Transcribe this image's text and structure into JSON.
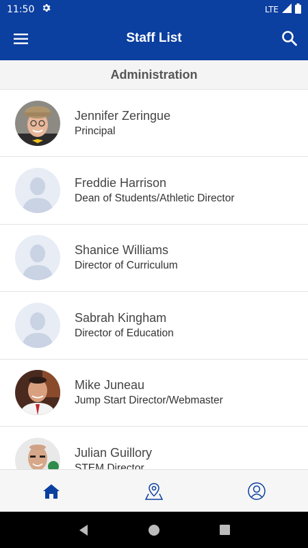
{
  "status_bar": {
    "time": "11:50",
    "network": "LTE",
    "icons": [
      "gear-icon",
      "signal-icon",
      "battery-icon"
    ]
  },
  "app_bar": {
    "title": "Staff List",
    "icons": [
      "menu-icon",
      "search-icon"
    ]
  },
  "section": {
    "title": "Administration"
  },
  "staff": [
    {
      "name": "Jennifer Zeringue",
      "title": "Principal",
      "avatar": "photo"
    },
    {
      "name": "Freddie Harrison",
      "title": "Dean of Students/Athletic Director",
      "avatar": "placeholder"
    },
    {
      "name": "Shanice Williams",
      "title": "Director of Curriculum",
      "avatar": "placeholder"
    },
    {
      "name": "Sabrah Kingham",
      "title": "Director of Education",
      "avatar": "placeholder"
    },
    {
      "name": "Mike Juneau",
      "title": "Jump Start Director/Webmaster",
      "avatar": "photo"
    },
    {
      "name": "Julian Guillory",
      "title": "STEM Director",
      "avatar": "photo"
    }
  ],
  "bottom_nav": {
    "items": [
      "home-icon",
      "map-pin-icon",
      "profile-icon"
    ],
    "active": "home-icon"
  },
  "colors": {
    "brand": "#0b3fa0",
    "placeholder_bg": "#e7ecf5",
    "placeholder_fg": "#c9d3e3"
  }
}
